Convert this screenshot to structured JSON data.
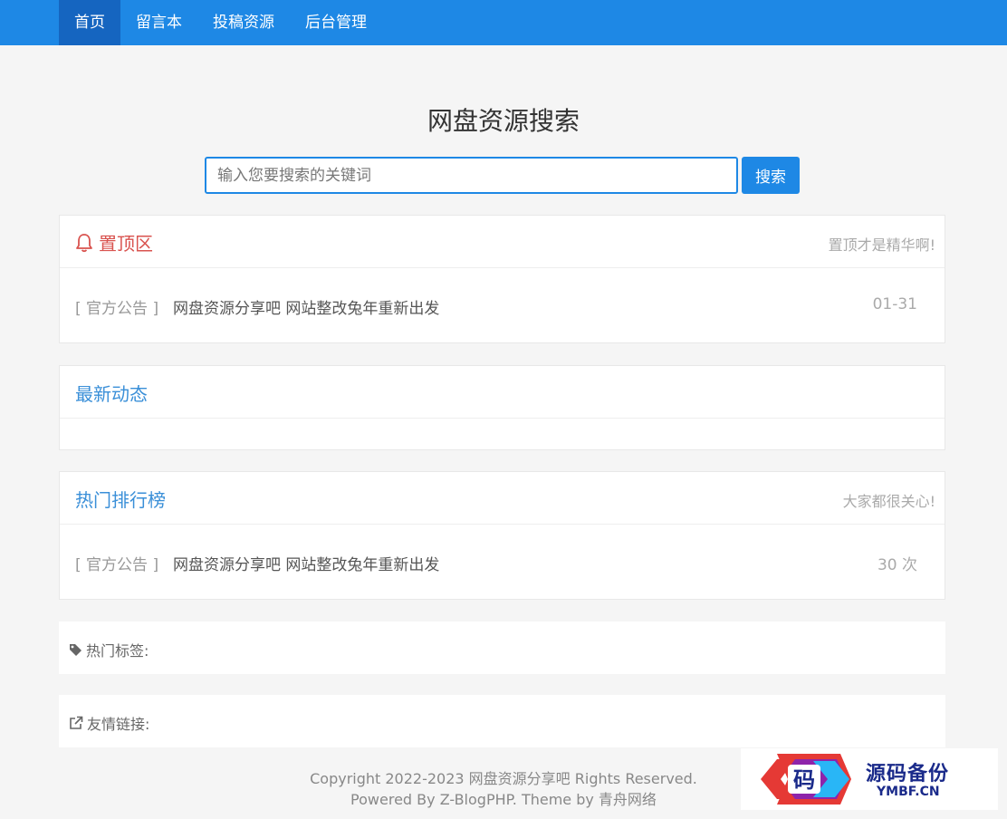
{
  "nav": {
    "items": [
      {
        "label": "首页"
      },
      {
        "label": "留言本"
      },
      {
        "label": "投稿资源"
      },
      {
        "label": "后台管理"
      }
    ]
  },
  "search": {
    "title": "网盘资源搜索",
    "placeholder": "输入您要搜索的关键词",
    "button": "搜索"
  },
  "pinned": {
    "title": "置顶区",
    "note": "置顶才是精华啊!",
    "rows": [
      {
        "category": "[ 官方公告 ]",
        "title": "网盘资源分享吧 网站整改兔年重新出发",
        "meta": "01-31"
      }
    ]
  },
  "latest": {
    "title": "最新动态"
  },
  "ranking": {
    "title": "热门排行榜",
    "note": "大家都很关心!",
    "rows": [
      {
        "category": "[ 官方公告 ]",
        "title": "网盘资源分享吧 网站整改兔年重新出发",
        "meta": "30 次"
      }
    ]
  },
  "tags": {
    "label": "热门标签:"
  },
  "links": {
    "label": "友情链接:"
  },
  "footer": {
    "line1": "Copyright 2022-2023 网盘资源分享吧 Rights Reserved.",
    "line2": "Powered By Z-BlogPHP. Theme by 青舟网络"
  },
  "watermark": {
    "text": "源码备份",
    "sub": "YMBF.CN",
    "glyph": "码",
    "colors": {
      "primary": "#1a2a8a",
      "accent1": "#e53935",
      "accent2": "#8e24aa",
      "accent3": "#29b6f6"
    }
  },
  "theme": {
    "brand": "#1e88e5",
    "brand_dark": "#1565c0",
    "red": "#d9534f",
    "link_blue": "#3a8fd8"
  }
}
